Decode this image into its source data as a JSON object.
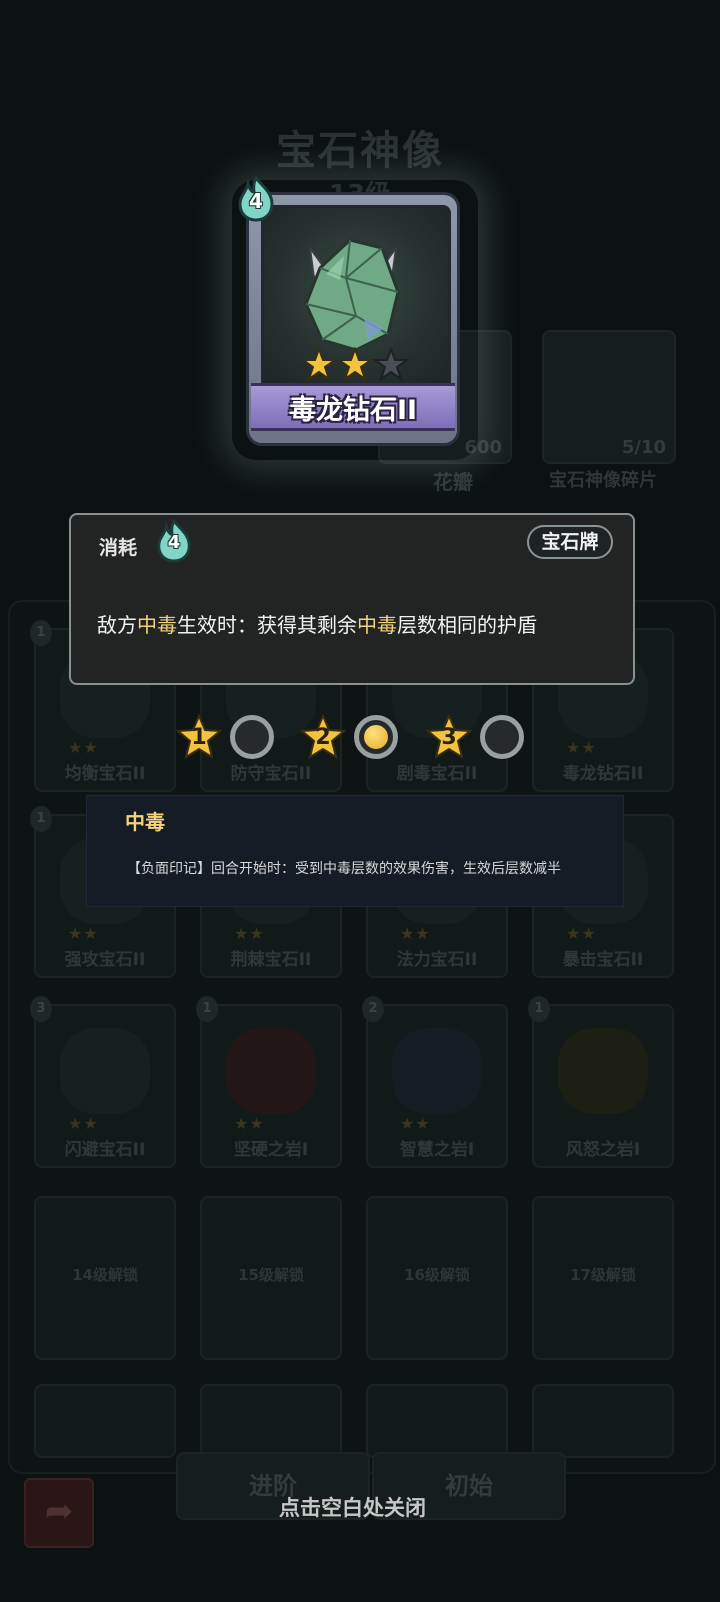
{
  "background": {
    "title": "宝石神像",
    "subtitle": "13级",
    "resources": [
      {
        "label": "花瓣",
        "count": "600"
      },
      {
        "label": "宝石神像碎片",
        "count": "5/10"
      }
    ],
    "cards": [
      {
        "name": "均衡宝石II",
        "cost": "1"
      },
      {
        "name": "防守宝石II",
        "cost": ""
      },
      {
        "name": "剧毒宝石II",
        "cost": ""
      },
      {
        "name": "毒龙钻石II",
        "cost": ""
      },
      {
        "name": "强攻宝石II",
        "cost": "1"
      },
      {
        "name": "荆棘宝石II",
        "cost": ""
      },
      {
        "name": "法力宝石II",
        "cost": ""
      },
      {
        "name": "暴击宝石II",
        "cost": ""
      },
      {
        "name": "闪避宝石II",
        "cost": "3"
      },
      {
        "name": "坚硬之岩I",
        "cost": "1"
      },
      {
        "name": "智慧之岩I",
        "cost": "2"
      },
      {
        "name": "风怒之岩I",
        "cost": "1"
      }
    ],
    "locked": [
      "14级解锁",
      "15级解锁",
      "16级解锁",
      "17级解锁"
    ],
    "buttons": {
      "advance": "进阶",
      "reset": "初始"
    }
  },
  "card": {
    "name": "毒龙钻石II",
    "cost": "4",
    "stars_filled": 2,
    "stars_total": 3,
    "colors": {
      "ribbon": "#8f82c8",
      "frame": "#7c8596",
      "gem": "#6fa986"
    }
  },
  "info": {
    "cost_label": "消耗",
    "cost_value": "4",
    "tag": "宝石牌",
    "desc_part1": "敌方",
    "desc_kw1": "中毒",
    "desc_part2": "生效时：获得其剩余",
    "desc_kw2": "中毒",
    "desc_part3": "层数相同的护盾",
    "keyword_color": "#f3d37b"
  },
  "levels": [
    {
      "num": "1",
      "selected": false
    },
    {
      "num": "2",
      "selected": true
    },
    {
      "num": "3",
      "selected": false
    }
  ],
  "keyword_tooltip": {
    "title": "中毒",
    "desc": "【负面印记】回合开始时：受到中毒层数的效果伤害，生效后层数减半"
  },
  "close_hint": "点击空白处关闭"
}
